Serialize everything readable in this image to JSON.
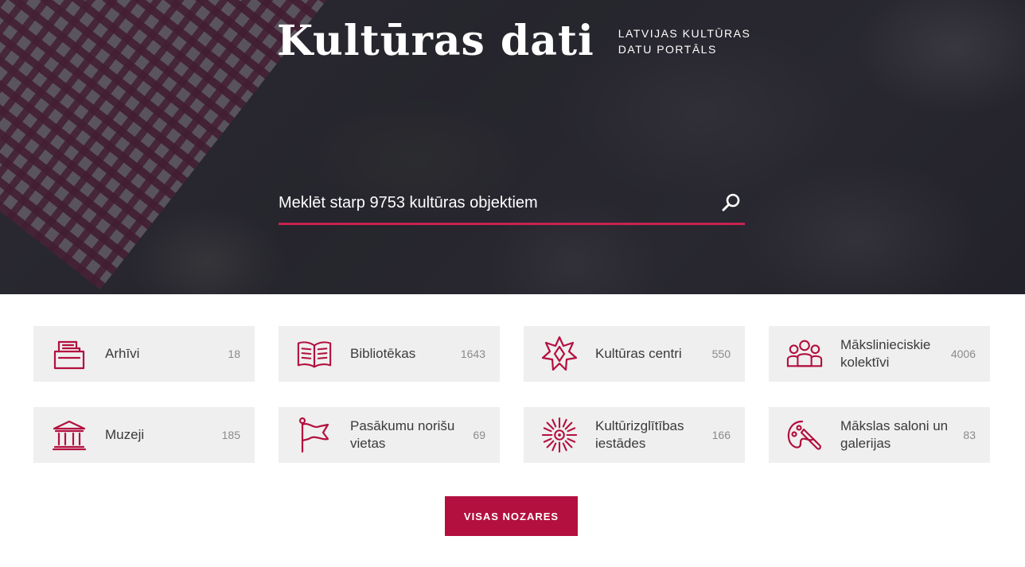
{
  "header": {
    "title": "Kultūras dati",
    "subtitle_line1": "LATVIJAS KULTŪRAS",
    "subtitle_line2": "DATU PORTĀLS"
  },
  "search": {
    "placeholder": "Meklēt starp 9753 kultūras objektiem",
    "icon": "search-icon"
  },
  "categories": [
    {
      "label": "Arhīvi",
      "count": "18",
      "icon": "archive-icon"
    },
    {
      "label": "Bibliotēkas",
      "count": "1643",
      "icon": "book-icon"
    },
    {
      "label": "Kultūras centri",
      "count": "550",
      "icon": "star-ornament-icon"
    },
    {
      "label": "Mākslinieciskie kolektīvi",
      "count": "4006",
      "icon": "people-group-icon"
    },
    {
      "label": "Muzeji",
      "count": "185",
      "icon": "museum-icon"
    },
    {
      "label": "Pasākumu norišu vietas",
      "count": "69",
      "icon": "flag-icon"
    },
    {
      "label": "Kultūrizglītības iestādes",
      "count": "166",
      "icon": "sun-ornament-icon"
    },
    {
      "label": "Mākslas saloni un galerijas",
      "count": "83",
      "icon": "palette-icon"
    }
  ],
  "all_button_label": "VISAS NOZARES",
  "colors": {
    "accent": "#b3103f",
    "search_underline": "#c8234f",
    "card_bg": "#efefef"
  }
}
